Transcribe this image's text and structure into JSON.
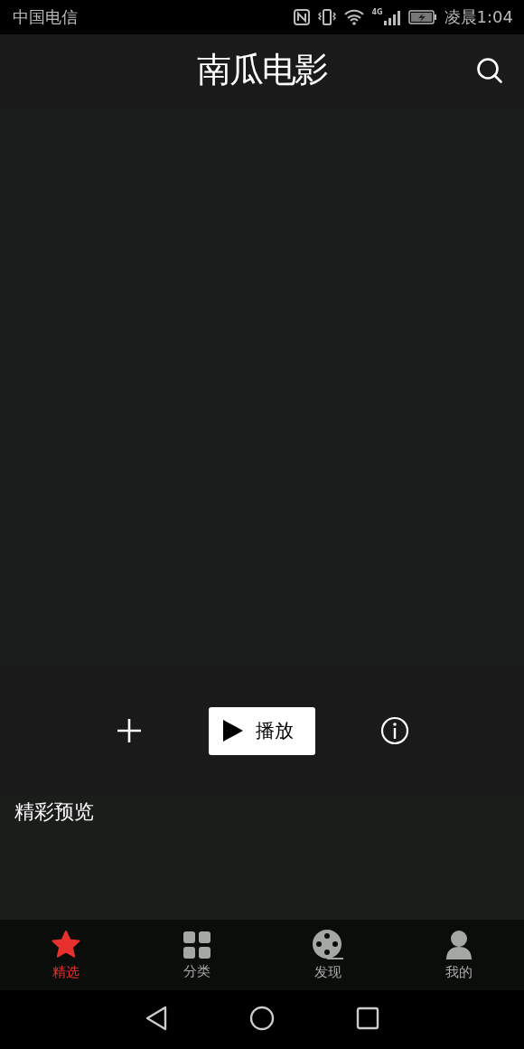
{
  "status_bar": {
    "carrier": "中国电信",
    "network": "4G",
    "time": "凌晨1:04"
  },
  "header": {
    "title": "南瓜电影"
  },
  "actions": {
    "play_label": "播放"
  },
  "section": {
    "title": "精彩预览"
  },
  "tabs": [
    {
      "label": "精选",
      "kind": "star",
      "selected": true
    },
    {
      "label": "分类",
      "kind": "grid",
      "selected": false
    },
    {
      "label": "发现",
      "kind": "film",
      "selected": false
    },
    {
      "label": "我的",
      "kind": "person",
      "selected": false
    }
  ]
}
